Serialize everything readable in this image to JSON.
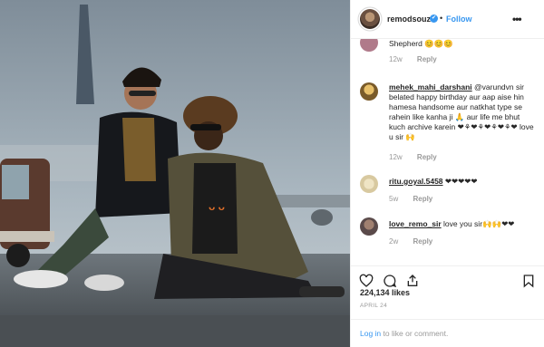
{
  "post": {
    "username": "remodsouza",
    "verified_mark": "✔",
    "separator": "•",
    "follow_label": "Follow",
    "more_label": "•••"
  },
  "comments": [
    {
      "username": "",
      "text": "Shepherd 😊😊😊",
      "time": "12w",
      "reply_label": "Reply",
      "avatar_color": "#b07a8a"
    },
    {
      "username": "mehek_mahi_darshani",
      "text": "@varundvn sir belated happy birthday aur aap aise hin hamesa handsome aur natkhat type se rahein like kanha ji 🙏 aur life me bhut kuch archive karein ❤⚘❤⚘❤⚘❤⚘❤ love u sir 🙌",
      "time": "12w",
      "reply_label": "Reply",
      "avatar_color": "#7a5b2a"
    },
    {
      "username": "ritu.goyal.5458",
      "text": "❤❤❤❤❤",
      "time": "5w",
      "reply_label": "Reply",
      "avatar_color": "#d8c9a0"
    },
    {
      "username": "love_remo_sir",
      "text": "love you sir🙌🙌❤❤",
      "time": "2w",
      "reply_label": "Reply",
      "avatar_color": "#5a4a4a"
    }
  ],
  "stats": {
    "likes": "224,134 likes",
    "date": "APRIL 24"
  },
  "login": {
    "link_label": "Log in",
    "rest_text": " to like or comment."
  },
  "icons": [
    "heart-icon",
    "comment-icon",
    "share-icon",
    "bookmark-icon",
    "more-icon",
    "verified-icon"
  ],
  "colors": {
    "accent": "#3897f0",
    "muted": "#999999",
    "border": "#efefef"
  }
}
